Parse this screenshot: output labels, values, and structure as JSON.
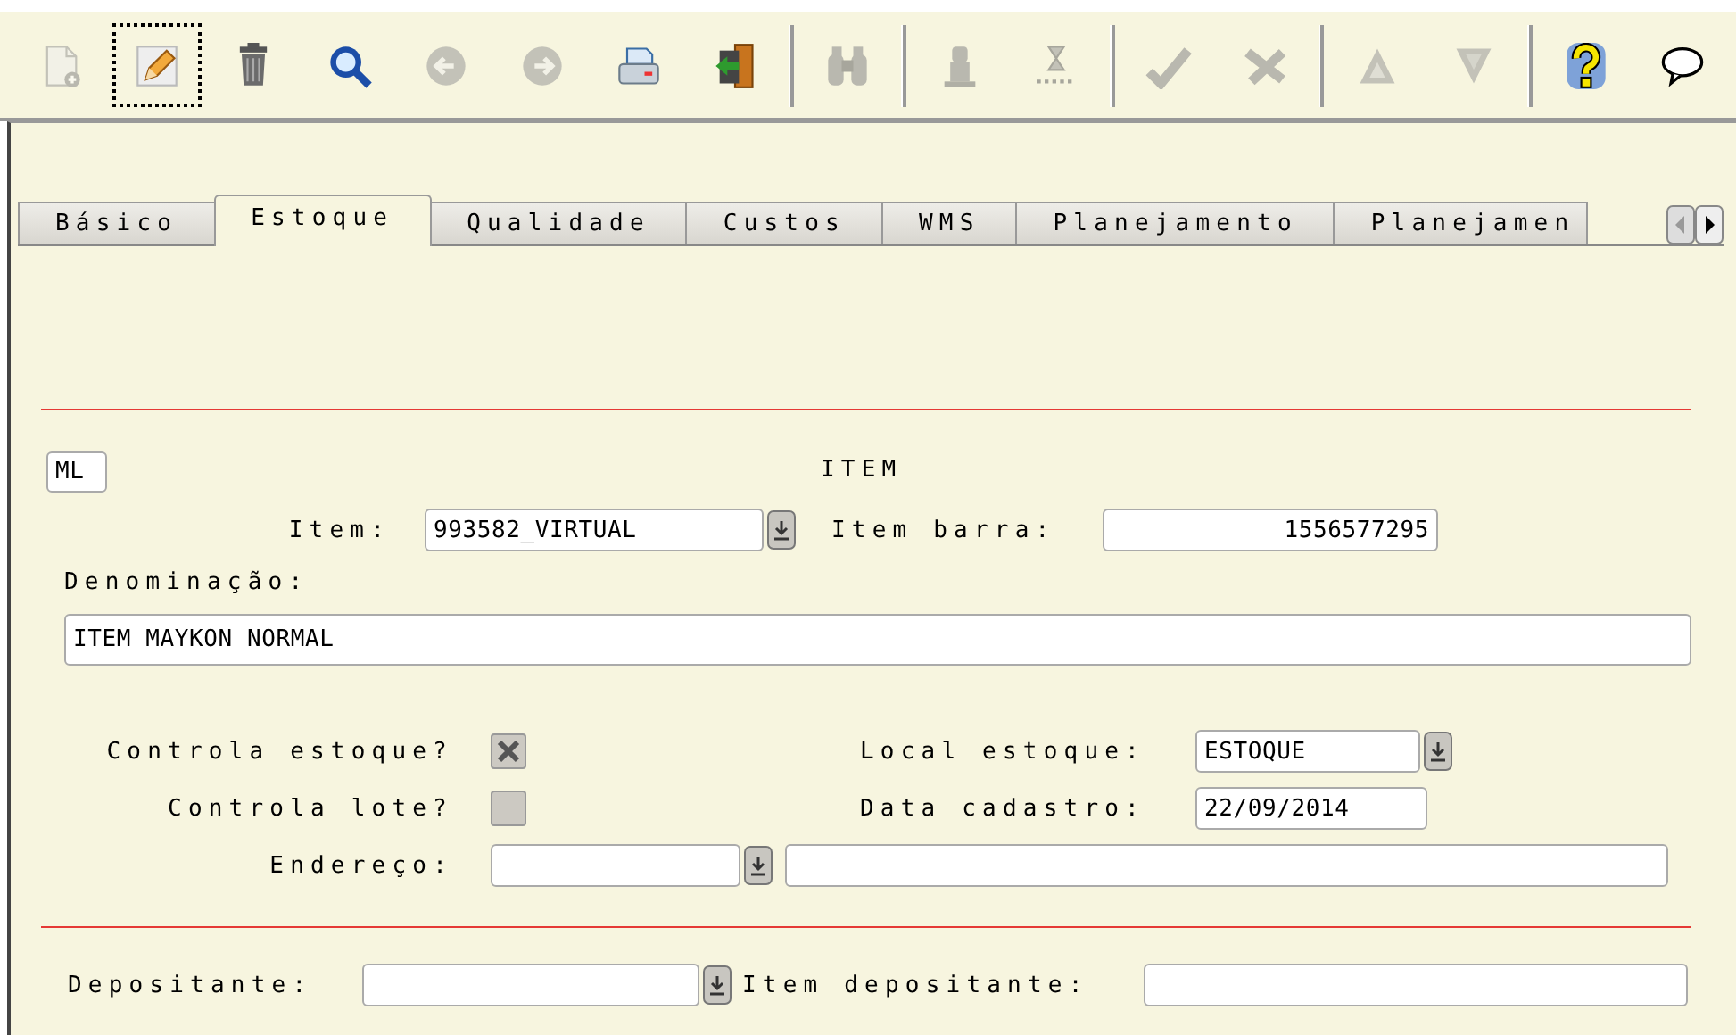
{
  "toolbar": {
    "groups": [
      [
        {
          "kind": "new",
          "disabled": true,
          "focused": false
        },
        {
          "kind": "edit",
          "disabled": false,
          "focused": true
        },
        {
          "kind": "delete",
          "disabled": false,
          "focused": false
        },
        {
          "kind": "search",
          "disabled": false,
          "focused": false
        },
        {
          "kind": "previous",
          "disabled": true,
          "focused": false
        },
        {
          "kind": "next",
          "disabled": true,
          "focused": false
        },
        {
          "kind": "print",
          "disabled": false,
          "focused": false
        },
        {
          "kind": "exit",
          "disabled": false,
          "focused": false
        }
      ],
      [
        {
          "kind": "find",
          "disabled": true,
          "focused": false
        }
      ],
      [
        {
          "kind": "figure",
          "disabled": true,
          "focused": false
        },
        {
          "kind": "hourglass",
          "disabled": true,
          "focused": false
        }
      ],
      [
        {
          "kind": "confirm",
          "disabled": true,
          "focused": false
        },
        {
          "kind": "cancel",
          "disabled": true,
          "focused": false
        }
      ],
      [
        {
          "kind": "up",
          "disabled": true,
          "focused": false
        },
        {
          "kind": "down",
          "disabled": true,
          "focused": false
        }
      ],
      [
        {
          "kind": "help",
          "disabled": false,
          "focused": false
        },
        {
          "kind": "comment",
          "disabled": false,
          "focused": false
        }
      ]
    ]
  },
  "tabs": [
    {
      "label": "Básico",
      "selected": false
    },
    {
      "label": "Estoque",
      "selected": true
    },
    {
      "label": "Qualidade",
      "selected": false
    },
    {
      "label": "Custos",
      "selected": false
    },
    {
      "label": "WMS",
      "selected": false
    },
    {
      "label": "Planejamento",
      "selected": false
    },
    {
      "label": "Planejamen",
      "selected": false
    }
  ],
  "form": {
    "code_field": {
      "value": "ML"
    },
    "section_title": "ITEM",
    "item": {
      "label": "Item:",
      "value": "993582_VIRTUAL"
    },
    "barcode": {
      "label": "Item barra:",
      "value": "1556577295"
    },
    "description": {
      "label": "Denominação:",
      "value": "ITEM MAYKON NORMAL"
    },
    "checkboxes": [
      {
        "label": "Controla estoque?",
        "checked": true
      },
      {
        "label": "Controla lote?",
        "checked": false
      }
    ],
    "stock_location": {
      "label": "Local estoque:",
      "value": "ESTOQUE"
    },
    "registration_date": {
      "label": "Data cadastro:",
      "value": "22/09/2014"
    },
    "address": {
      "label": "Endereço:"
    },
    "depositor": {
      "label": "Depositante:"
    },
    "depositor_item": {
      "label": "Item depositante:"
    }
  }
}
